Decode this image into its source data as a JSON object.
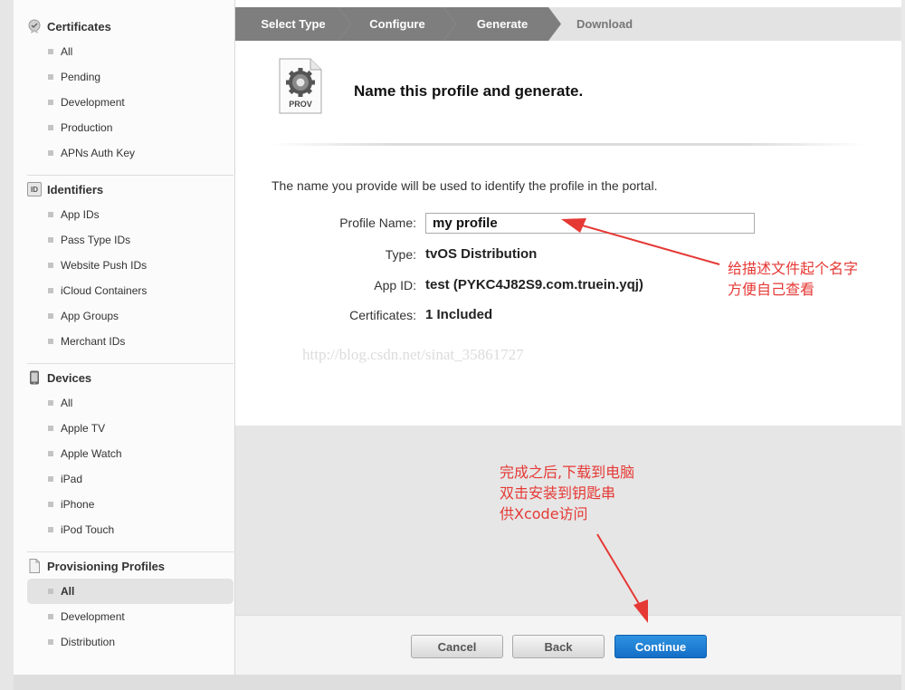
{
  "sidebar": {
    "certificates": {
      "title": "Certificates",
      "items": [
        "All",
        "Pending",
        "Development",
        "Production",
        "APNs Auth Key"
      ]
    },
    "identifiers": {
      "title": "Identifiers",
      "icon_text": "ID",
      "items": [
        "App IDs",
        "Pass Type IDs",
        "Website Push IDs",
        "iCloud Containers",
        "App Groups",
        "Merchant IDs"
      ]
    },
    "devices": {
      "title": "Devices",
      "items": [
        "All",
        "Apple TV",
        "Apple Watch",
        "iPad",
        "iPhone",
        "iPod Touch"
      ]
    },
    "provisioning": {
      "title": "Provisioning Profiles",
      "items": [
        "All",
        "Development",
        "Distribution"
      ],
      "active_item": "All"
    }
  },
  "steps": [
    "Select Type",
    "Configure",
    "Generate",
    "Download"
  ],
  "main": {
    "icon_label": "PROV",
    "heading": "Name this profile and generate.",
    "description": "The name you provide will be used to identify the profile in the portal.",
    "fields": {
      "profile_name_label": "Profile Name:",
      "profile_name_value": "my profile",
      "type_label": "Type:",
      "type_value": "tvOS Distribution",
      "app_id_label": "App ID:",
      "app_id_value": "test (PYKC4J82S9.com.truein.yqj)",
      "certificates_label": "Certificates:",
      "certificates_value": "1 Included"
    },
    "watermark": "http://blog.csdn.net/sinat_35861727"
  },
  "buttons": {
    "cancel": "Cancel",
    "back": "Back",
    "continue": "Continue"
  },
  "annotations": {
    "name_note_line1": "给描述文件起个名字",
    "name_note_line2": "方便自己查看",
    "download_note_line1": "完成之后,下载到电脑",
    "download_note_line2": "双击安装到钥匙串",
    "download_note_line3": "供Xcode访问"
  },
  "colors": {
    "accent_blue": "#1a7fd6",
    "annotation_red": "#e53935",
    "step_dark": "#7e7e7e"
  }
}
